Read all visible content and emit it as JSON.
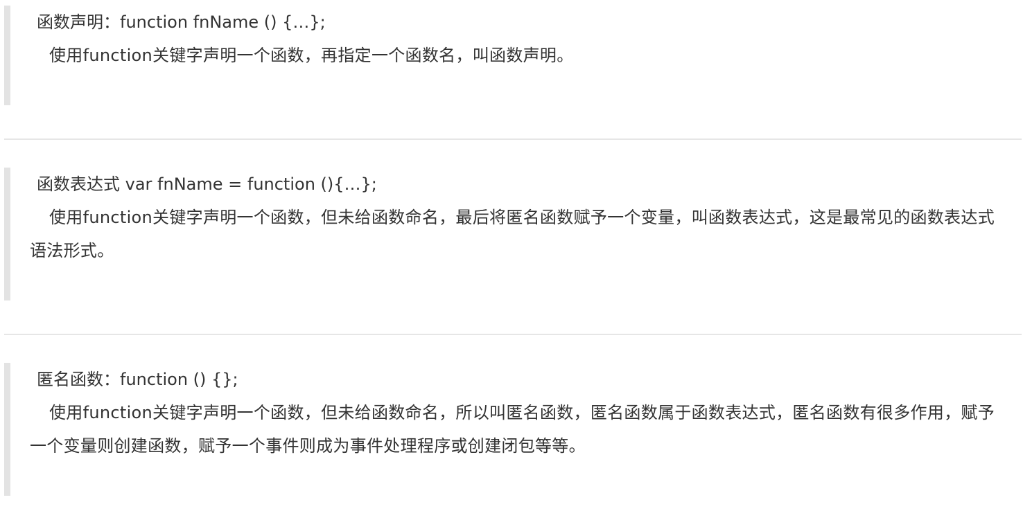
{
  "sections": [
    {
      "heading": "函数声明：function fnName () {…};",
      "body": "使用function关键字声明一个函数，再指定一个函数名，叫函数声明。"
    },
    {
      "heading": "函数表达式 var fnName = function (){…};",
      "body": "使用function关键字声明一个函数，但未给函数命名，最后将匿名函数赋予一个变量，叫函数表达式，这是最常见的函数表达式语法形式。"
    },
    {
      "heading": "匿名函数：function () {};",
      "body": "使用function关键字声明一个函数，但未给函数命名，所以叫匿名函数，匿名函数属于函数表达式，匿名函数有很多作用，赋予一个变量则创建函数，赋予一个事件则成为事件处理程序或创建闭包等等。"
    }
  ]
}
